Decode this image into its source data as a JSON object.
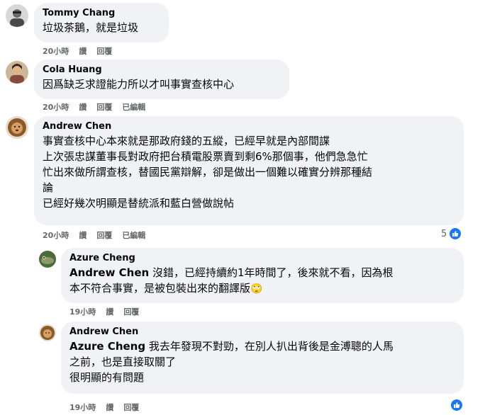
{
  "comments": [
    {
      "author": "Tommy Chang",
      "text": "垃圾茶鵝，就是垃圾",
      "time": "20小時",
      "like_label": "讚",
      "reply_label": "回覆"
    },
    {
      "author": "Cola Huang",
      "text": "因爲缺乏求證能力所以才叫事實查核中心",
      "time": "20小時",
      "like_label": "讚",
      "reply_label": "回覆",
      "edited_label": "已編輯"
    },
    {
      "author": "Andrew Chen",
      "lines": [
        "事實查核中心本來就是那政府錢的五縱，已經早就是內部間諜",
        "上次張忠謀董事長對政府把台積電股票賣到剩6%那個事，他們急急忙",
        "忙出來做所謂查核，替國民黨辯解，卻是做出一個難以確實分辨那種結",
        "論",
        "已經好幾次明顯是替統派和藍白營做說帖"
      ],
      "time": "20小時",
      "like_label": "讚",
      "reply_label": "回覆",
      "edited_label": "已編輯",
      "reaction_count": "5"
    }
  ],
  "replies": [
    {
      "author": "Azure Cheng",
      "mention": "Andrew Chen",
      "line1": " 沒錯，已經持續約1年時間了，後來就不看，因為根",
      "line2": "本不符合事實，是被包裝出來的翻譯版",
      "emoji": "🙄",
      "time": "19小時",
      "like_label": "讚",
      "reply_label": "回覆"
    },
    {
      "author": "Andrew Chen",
      "mention": "Azure Cheng",
      "line1": " 我去年發現不對勁，在別人扒出背後是金溥聰的人馬",
      "line2": "之前，也是直接取關了",
      "line3": "很明顯的有問題",
      "time": "19小時",
      "like_label": "讚",
      "reply_label": "回覆"
    }
  ],
  "colors": {
    "bubble": "#f0f2f5",
    "meta": "#65676b",
    "like_blue": "#1877f2"
  }
}
